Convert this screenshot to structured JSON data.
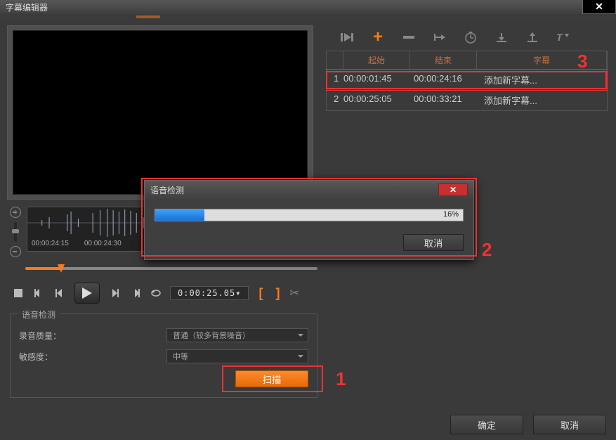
{
  "window": {
    "title": "字幕编辑器"
  },
  "dialog": {
    "title": "语音检测",
    "progress_pct": "16%",
    "progress_width": "16%",
    "cancel_label": "取消"
  },
  "waveform": {
    "times": [
      "00:00:24:15",
      "00:00:24:30"
    ]
  },
  "playback": {
    "timecode": "0:00:25.05▾"
  },
  "voice_detect": {
    "legend": "语音检测",
    "quality_label": "录音质量：",
    "quality_value": "普通（较多背景噪音）",
    "sensitivity_label": "敏感度：",
    "sensitivity_value": "中等",
    "scan_label": "扫描"
  },
  "subtable": {
    "headers": {
      "start": "起始",
      "end": "结束",
      "text": "字幕"
    },
    "rows": [
      {
        "idx": "1",
        "start": "00:00:01:45",
        "end": "00:00:24:16",
        "text": "添加新字幕...",
        "selected": true
      },
      {
        "idx": "2",
        "start": "00:00:25:05",
        "end": "00:00:33:21",
        "text": "添加新字幕...",
        "selected": false
      }
    ]
  },
  "footer": {
    "ok": "确定",
    "cancel": "取消"
  },
  "annotations": {
    "n1": "1",
    "n2": "2",
    "n3": "3"
  }
}
